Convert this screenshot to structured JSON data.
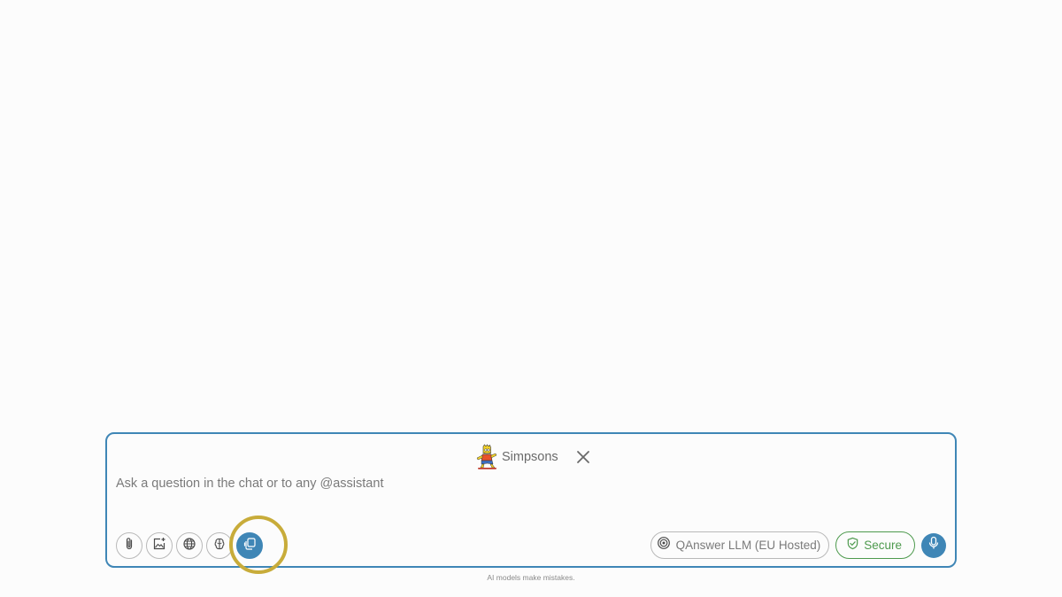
{
  "composer": {
    "assistant": {
      "name": "Simpsons",
      "avatar_icon": "bart-simpson-avatar-icon",
      "close_icon": "close-icon"
    },
    "placeholder": "Ask a question in the chat or to any @assistant",
    "tools": [
      {
        "name": "attach-file-button",
        "icon": "paperclip-icon"
      },
      {
        "name": "add-image-button",
        "icon": "image-plus-icon"
      },
      {
        "name": "web-search-button",
        "icon": "globe-icon"
      },
      {
        "name": "brain-button",
        "icon": "brain-icon"
      },
      {
        "name": "collections-button",
        "icon": "copy-documents-icon",
        "active": true
      }
    ],
    "model": {
      "label": "QAnswer LLM (EU Hosted)",
      "icon": "target-icon"
    },
    "secure": {
      "label": "Secure",
      "icon": "shield-check-icon"
    },
    "mic_icon": "microphone-icon"
  },
  "footer": {
    "note": "AI models make mistakes."
  },
  "colors": {
    "accent": "#3f86b6",
    "secure_green": "#4e9a4e",
    "highlight": "#c8ac3a"
  }
}
